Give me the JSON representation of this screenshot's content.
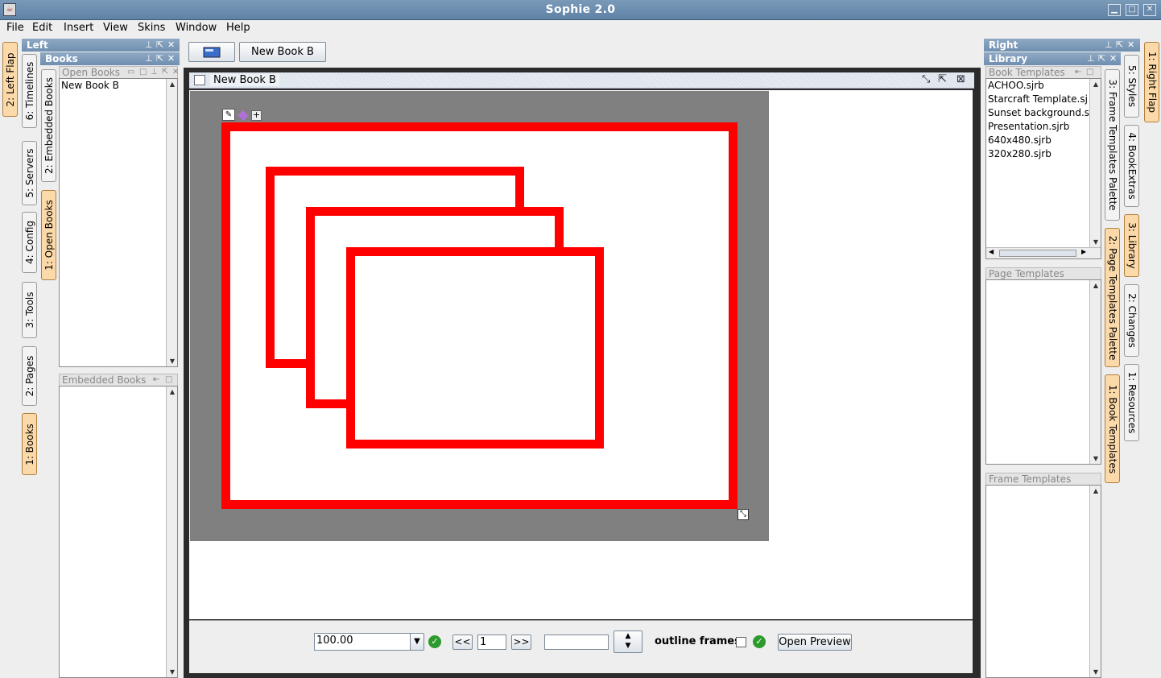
{
  "window": {
    "title": "Sophie 2.0",
    "icon": "java-icon",
    "controls": [
      "minimize-icon",
      "maximize-icon",
      "close-icon"
    ]
  },
  "menu": [
    "File",
    "Edit",
    "Insert",
    "View",
    "Skins",
    "Window",
    "Help"
  ],
  "left_flap": {
    "label": "2: Left Flap"
  },
  "left_tabs": [
    {
      "label": "6: Timelines",
      "selected": false
    },
    {
      "label": "5: Servers",
      "selected": false
    },
    {
      "label": "4: Config",
      "selected": false
    },
    {
      "label": "3: Tools",
      "selected": false
    },
    {
      "label": "2: Pages",
      "selected": false
    },
    {
      "label": "1: Books",
      "selected": true
    }
  ],
  "books_tabs": [
    {
      "label": "2: Embedded Books",
      "selected": false
    },
    {
      "label": "1: Open Books",
      "selected": true
    }
  ],
  "left_panel": {
    "title": "Left",
    "books_title": "Books",
    "open_books": {
      "title": "Open Books",
      "items": [
        "New Book B"
      ]
    },
    "embedded_books": {
      "title": "Embedded Books",
      "items": []
    }
  },
  "center": {
    "toolbar_tab_label": "New Book B",
    "doc_title": "New Book B",
    "bottom": {
      "zoom_value": "100.00",
      "prev_label": "<<",
      "page_value": "1",
      "next_label": ">>",
      "search_value": "",
      "outline_frames_label": "outline frames",
      "outline_frames_checked": false,
      "open_preview_label": "Open Preview"
    },
    "frame_colors": {
      "border": "#ff0000",
      "page": "#808080"
    }
  },
  "right_panel": {
    "title": "Right",
    "library_title": "Library",
    "book_templates": {
      "title": "Book Templates",
      "items": [
        "ACHOO.sjrb",
        "Starcraft Template.sj",
        "Sunset background.s",
        "Presentation.sjrb",
        "640x480.sjrb",
        "320x280.sjrb"
      ]
    },
    "page_templates": {
      "title": "Page Templates Palette"
    },
    "frame_templates": {
      "title": "Frame Templates Palette"
    }
  },
  "right_inner_tabs": [
    {
      "label": "3: Frame Templates Palette",
      "selected": false
    },
    {
      "label": "2: Page Templates Palette",
      "selected": true
    },
    {
      "label": "1: Book Templates",
      "selected": true
    }
  ],
  "right_tabs": [
    {
      "label": "5: Styles",
      "selected": false
    },
    {
      "label": "4: BookExtras",
      "selected": false
    },
    {
      "label": "3: Library",
      "selected": true
    },
    {
      "label": "2: Changes",
      "selected": false
    },
    {
      "label": "1: Resources",
      "selected": false
    }
  ],
  "right_flap": {
    "label": "1: Right Flap"
  }
}
